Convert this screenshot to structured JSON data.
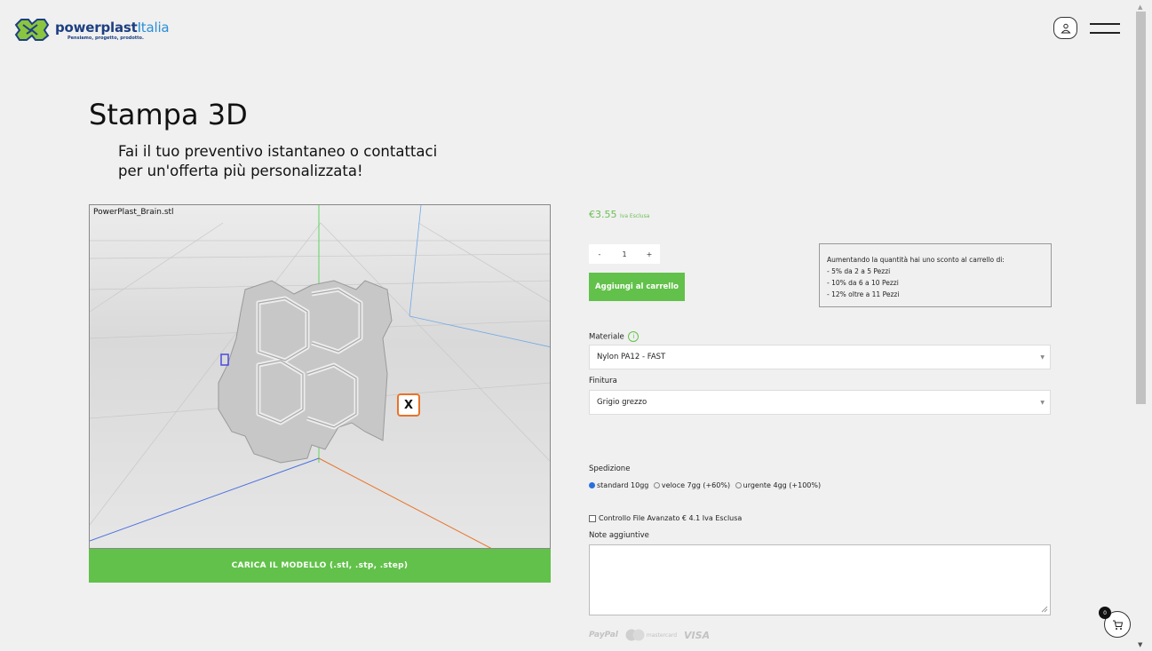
{
  "header": {
    "brand_name": "powerplast",
    "brand_suffix": "Italia",
    "tagline": "Pensiamo, progetto, prodotto.",
    "icons": [
      "logo-icon",
      "user-icon",
      "hamburger-menu-icon"
    ]
  },
  "page": {
    "title": "Stampa 3D",
    "subtitle_line1": "Fai il tuo preventivo istantaneo o contattaci",
    "subtitle_line2": "per un'offerta più personalizzata!"
  },
  "viewer": {
    "filename": "PowerPlast_Brain.stl",
    "axis_marker": "X",
    "upload_label": "CARICA IL MODELLO (.stl, .stp, .step)"
  },
  "product": {
    "price": "€3.55",
    "vat_note": "Iva Esclusa",
    "qty_minus": "-",
    "qty_value": "1",
    "qty_plus": "+",
    "add_to_cart": "Aggiungi al carrello",
    "discount": {
      "intro": "Aumentando la quantità hai uno sconto al carrello di:",
      "lines": [
        "- 5% da 2 a 5 Pezzi",
        "- 10% da 6 a 10 Pezzi",
        "- 12% oltre a 11 Pezzi"
      ]
    },
    "material_label": "Materiale",
    "material_value": "Nylon PA12 - FAST",
    "finish_label": "Finitura",
    "finish_value": "Grigio grezzo",
    "shipping_label": "Spedizione",
    "shipping_options": [
      {
        "label": "standard 10gg",
        "selected": true
      },
      {
        "label": "veloce 7gg (+60%)",
        "selected": false
      },
      {
        "label": "urgente 4gg (+100%)",
        "selected": false
      }
    ],
    "advanced_check_label": "Controllo File Avanzato € 4.1 Iva Esclusa",
    "notes_label": "Note aggiuntive",
    "payment_methods": [
      "PayPal",
      "mastercard",
      "VISA"
    ]
  },
  "cart": {
    "count": "0"
  },
  "colors": {
    "accent_green": "#62c14a",
    "brand_blue": "#1d3f82",
    "axis_orange": "#e8732a"
  }
}
